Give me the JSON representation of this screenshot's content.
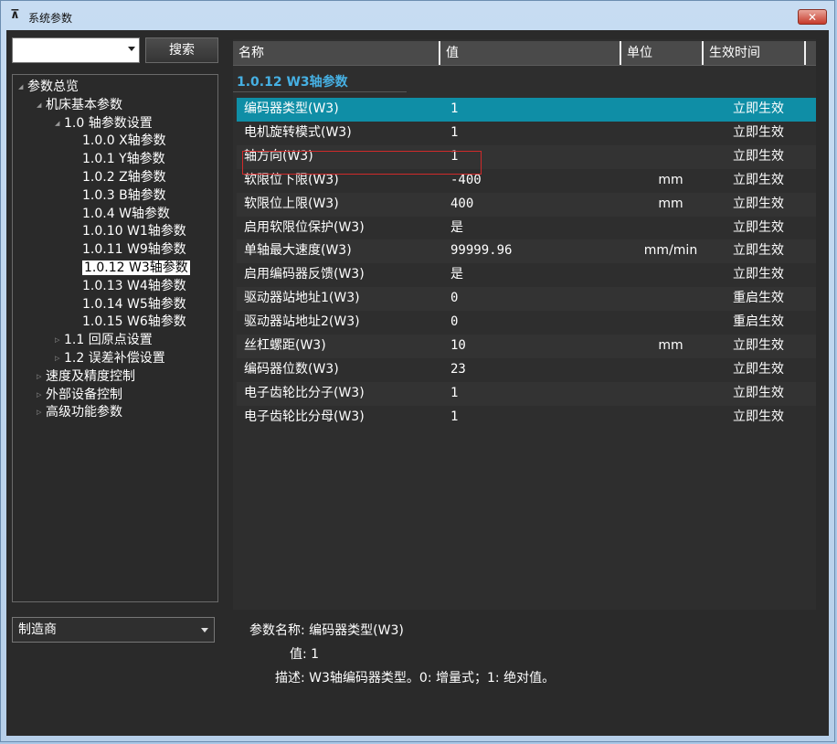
{
  "window": {
    "title": "系统参数",
    "close_label": "✕"
  },
  "search": {
    "value": "",
    "button_label": "搜索"
  },
  "tree": {
    "items": [
      {
        "label": "参数总览",
        "depth": 0,
        "toggle": "◢",
        "selected": false
      },
      {
        "label": "机床基本参数",
        "depth": 1,
        "toggle": "◢",
        "selected": false
      },
      {
        "label": "1.0 轴参数设置",
        "depth": 2,
        "toggle": "◢",
        "selected": false
      },
      {
        "label": "1.0.0 X轴参数",
        "depth": 3,
        "toggle": "",
        "selected": false
      },
      {
        "label": "1.0.1 Y轴参数",
        "depth": 3,
        "toggle": "",
        "selected": false
      },
      {
        "label": "1.0.2 Z轴参数",
        "depth": 3,
        "toggle": "",
        "selected": false
      },
      {
        "label": "1.0.3 B轴参数",
        "depth": 3,
        "toggle": "",
        "selected": false
      },
      {
        "label": "1.0.4 W轴参数",
        "depth": 3,
        "toggle": "",
        "selected": false
      },
      {
        "label": "1.0.10 W1轴参数",
        "depth": 3,
        "toggle": "",
        "selected": false
      },
      {
        "label": "1.0.11 W9轴参数",
        "depth": 3,
        "toggle": "",
        "selected": false
      },
      {
        "label": "1.0.12 W3轴参数",
        "depth": 3,
        "toggle": "",
        "selected": true
      },
      {
        "label": "1.0.13 W4轴参数",
        "depth": 3,
        "toggle": "",
        "selected": false
      },
      {
        "label": "1.0.14 W5轴参数",
        "depth": 3,
        "toggle": "",
        "selected": false
      },
      {
        "label": "1.0.15 W6轴参数",
        "depth": 3,
        "toggle": "",
        "selected": false
      },
      {
        "label": "1.1 回原点设置",
        "depth": 2,
        "toggle": "▷",
        "selected": false
      },
      {
        "label": "1.2 误差补偿设置",
        "depth": 2,
        "toggle": "▷",
        "selected": false
      },
      {
        "label": "速度及精度控制",
        "depth": 1,
        "toggle": "▷",
        "selected": false
      },
      {
        "label": "外部设备控制",
        "depth": 1,
        "toggle": "▷",
        "selected": false
      },
      {
        "label": "高级功能参数",
        "depth": 1,
        "toggle": "▷",
        "selected": false
      }
    ]
  },
  "maker": {
    "value": "制造商"
  },
  "grid": {
    "headers": {
      "name": "名称",
      "value": "值",
      "unit": "单位",
      "effective": "生效时间"
    },
    "section_title": "1.0.12 W3轴参数",
    "rows": [
      {
        "name": "编码器类型(W3)",
        "value": "1",
        "unit": "",
        "effective": "立即生效"
      },
      {
        "name": "电机旋转模式(W3)",
        "value": "1",
        "unit": "",
        "effective": "立即生效"
      },
      {
        "name": "轴方向(W3)",
        "value": "1",
        "unit": "",
        "effective": "立即生效"
      },
      {
        "name": "软限位下限(W3)",
        "value": "-400",
        "unit": "mm",
        "effective": "立即生效"
      },
      {
        "name": "软限位上限(W3)",
        "value": "400",
        "unit": "mm",
        "effective": "立即生效"
      },
      {
        "name": "启用软限位保护(W3)",
        "value": "是",
        "unit": "",
        "effective": "立即生效"
      },
      {
        "name": "单轴最大速度(W3)",
        "value": "99999.96",
        "unit": "mm/min",
        "effective": "立即生效"
      },
      {
        "name": "启用编码器反馈(W3)",
        "value": "是",
        "unit": "",
        "effective": "立即生效"
      },
      {
        "name": "驱动器站地址1(W3)",
        "value": "0",
        "unit": "",
        "effective": "重启生效"
      },
      {
        "name": "驱动器站地址2(W3)",
        "value": "0",
        "unit": "",
        "effective": "重启生效"
      },
      {
        "name": "丝杠螺距(W3)",
        "value": "10",
        "unit": "mm",
        "effective": "立即生效"
      },
      {
        "name": "编码器位数(W3)",
        "value": "23",
        "unit": "",
        "effective": "立即生效"
      },
      {
        "name": "电子齿轮比分子(W3)",
        "value": "1",
        "unit": "",
        "effective": "立即生效"
      },
      {
        "name": "电子齿轮比分母(W3)",
        "value": "1",
        "unit": "",
        "effective": "立即生效"
      }
    ]
  },
  "detail": {
    "name_line": "参数名称: 编码器类型(W3)",
    "value_line": "值: 1",
    "desc_line": "描述: W3轴编码器类型。0: 增量式；1: 绝对值。"
  },
  "colors": {
    "accent": "#0f8ea6",
    "section": "#46b0e3",
    "highlight_box": "#d02a2a"
  },
  "icons": {
    "app": "axis-app-icon",
    "close": "close-icon"
  }
}
